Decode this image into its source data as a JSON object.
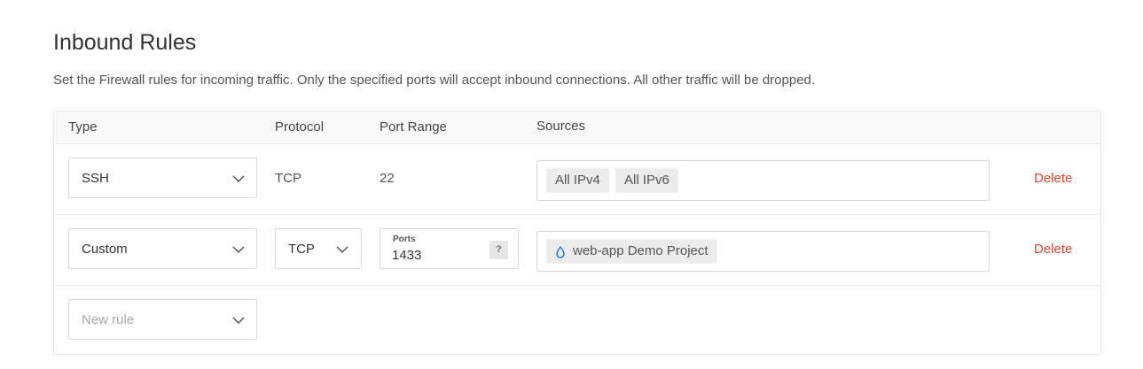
{
  "page": {
    "title": "Inbound Rules",
    "description": "Set the Firewall rules for incoming traffic. Only the specified ports will accept inbound connections. All other traffic will be dropped."
  },
  "table": {
    "headers": {
      "type": "Type",
      "protocol": "Protocol",
      "port_range": "Port Range",
      "sources": "Sources"
    },
    "rows": [
      {
        "type": "SSH",
        "protocol": "TCP",
        "port_range": "22",
        "sources": [
          "All IPv4",
          "All IPv6"
        ],
        "delete_label": "Delete"
      },
      {
        "type": "Custom",
        "protocol": "TCP",
        "ports_label": "Ports",
        "ports_value": "1433",
        "ports_help": "?",
        "sources": [
          "web-app Demo Project"
        ],
        "delete_label": "Delete"
      }
    ],
    "new_rule_placeholder": "New rule"
  },
  "colors": {
    "delete": "#e0462f",
    "tag_background": "#ececec",
    "droplet_icon": "#1a73e8"
  },
  "icons": [
    "chevron-down-icon",
    "droplet-icon"
  ]
}
